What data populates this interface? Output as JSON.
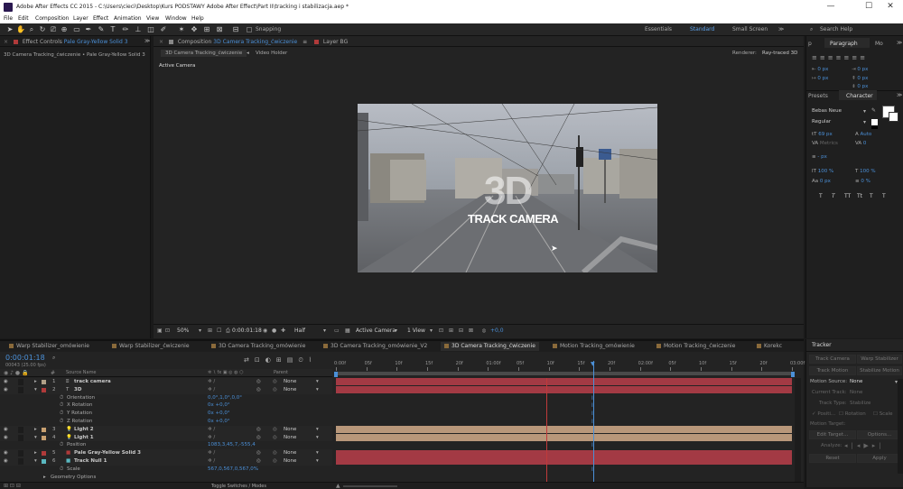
{
  "window": {
    "title": "Adobe After Effects CC 2015 - C:\\Users\\cieci\\Desktop\\Kurs PODSTAWY Adobe After Effect\\Part II\\tracking i stabilizacja.aep *",
    "min": "—",
    "max": "☐",
    "close": "✕"
  },
  "menu": [
    "File",
    "Edit",
    "Composition",
    "Layer",
    "Effect",
    "Animation",
    "View",
    "Window",
    "Help"
  ],
  "toolbar": {
    "snapping": "Snapping"
  },
  "workspaces": {
    "essentials": "Essentials",
    "standard": "Standard",
    "small": "Small Screen",
    "menu_icon": "≫",
    "search": "Search Help"
  },
  "effect_controls": {
    "label": "Effect Controls",
    "layer": "Pale Gray-Yellow Solid 3",
    "subtitle": "3D Camera Tracking_ćwiczenie • Pale Gray-Yellow Solid 3"
  },
  "composition_panel": {
    "label": "Composition",
    "name": "3D Camera Tracking_ćwiczenie",
    "layer_tab": "Layer BG",
    "breadcrumb_comp": "3D Camera Tracking_ćwiczenie",
    "breadcrumb_next": "Video Holder",
    "renderer_label": "Renderer:",
    "renderer_value": "Ray-traced 3D",
    "active_camera_label": "Active Camera"
  },
  "frame_text": {
    "big": "3D",
    "small": "TRACK CAMERA"
  },
  "viewer_bar": {
    "zoom": "50%",
    "timecode": "0:00:01:18",
    "resolution": "Half",
    "camera": "Active Camera",
    "views": "1 View",
    "exposure": "+0,0"
  },
  "right_panels": {
    "paragraph_tab": "Paragraph",
    "mo_tab": "Mo",
    "p_tab": "p",
    "para_values": [
      "0 px",
      "0 px",
      "0 px",
      "0 px",
      "0 px"
    ],
    "presets_tab": "Presets",
    "character_tab": "Character",
    "font": "Bebas Neue",
    "style": "Regular",
    "size": "69 px",
    "leading": "Auto",
    "kerning": "Metrics",
    "tracking": "0",
    "stroke": "- px",
    "vscale": "100 %",
    "hscale": "100 %",
    "baseline": "0 px",
    "tsume": "0 %",
    "text_buttons": [
      "T",
      "T",
      "TT",
      "Tt",
      "T",
      "T"
    ]
  },
  "timeline": {
    "tabs": [
      "Warp Stabilizer_omówienie",
      "Warp Stabilizer_ćwiczenie",
      "3D Camera Tracking_omówienie",
      "3D Camera Tracking_omówienie_V2",
      "3D Camera Tracking_ćwiczenie",
      "Motion Tracking_omówienie",
      "Motion Tracking_ćwiczenie",
      "Korekc"
    ],
    "active_tab": "3D Camera Tracking_ćwiczenie",
    "timecode": "0:00:01:18",
    "fps": "00043 (25.00 fps)",
    "col_source": "Source Name",
    "col_parent": "Parent",
    "ruler": [
      "0:00f",
      "05f",
      "10f",
      "15f",
      "20f",
      "01:00f",
      "05f",
      "10f",
      "15f",
      "20f",
      "02:00f",
      "05f",
      "10f",
      "15f",
      "20f",
      "03:00f"
    ],
    "toggle_label": "Toggle Switches / Modes",
    "layers": [
      {
        "num": "1",
        "name": "track camera",
        "type": "cam",
        "color": "#b0a088",
        "parent": "None",
        "bar": "#a33a44"
      },
      {
        "num": "2",
        "name": "3D",
        "type": "text",
        "color": "#b03a3a",
        "parent": "None",
        "bar": "#a33a44",
        "props": [
          {
            "name": "Orientation",
            "value": "0,0°,1,0°,0,0°"
          },
          {
            "name": "X Rotation",
            "value": "0x +0,0°"
          },
          {
            "name": "Y Rotation",
            "value": "0x +0,0°"
          },
          {
            "name": "Z Rotation",
            "value": "0x +0,0°"
          }
        ]
      },
      {
        "num": "3",
        "name": "Light 2",
        "type": "light",
        "color": "#c8a070",
        "parent": "None",
        "bar": "#b8977a"
      },
      {
        "num": "4",
        "name": "Light 1",
        "type": "light",
        "color": "#c8a070",
        "parent": "None",
        "bar": "#b8977a",
        "props": [
          {
            "name": "Position",
            "value": "1083,3,45,7,-555,4"
          }
        ]
      },
      {
        "num": "5",
        "name": "Pale Gray-Yellow Solid 3",
        "type": "solid",
        "color": "#b03a3a",
        "parent": "None",
        "bar": "#a33a44"
      },
      {
        "num": "6",
        "name": "Track Null 1",
        "type": "solid",
        "color": "#5ab8c0",
        "parent": "None",
        "bar": "#a33a44",
        "props": [
          {
            "name": "Scale",
            "value": "567,0,567,0,567,0%"
          }
        ]
      }
    ],
    "geometry": "Geometry Options"
  },
  "tracker": {
    "title": "Tracker",
    "btn_track_camera": "Track Camera",
    "btn_warp": "Warp Stabilizer",
    "btn_track_motion": "Track Motion",
    "btn_stabilize": "Stabilize Motion",
    "motion_source_label": "Motion Source:",
    "motion_source": "None",
    "current_track_label": "Current Track:",
    "current_track": "None",
    "track_type_label": "Track Type:",
    "track_type": "Stabilize",
    "position": "Positi...",
    "rotation": "Rotation",
    "scale": "Scale",
    "motion_target": "Motion Target:",
    "edit_target": "Edit Target...",
    "options": "Options...",
    "analyze": "Analyze:",
    "reset": "Reset",
    "apply": "Apply"
  }
}
